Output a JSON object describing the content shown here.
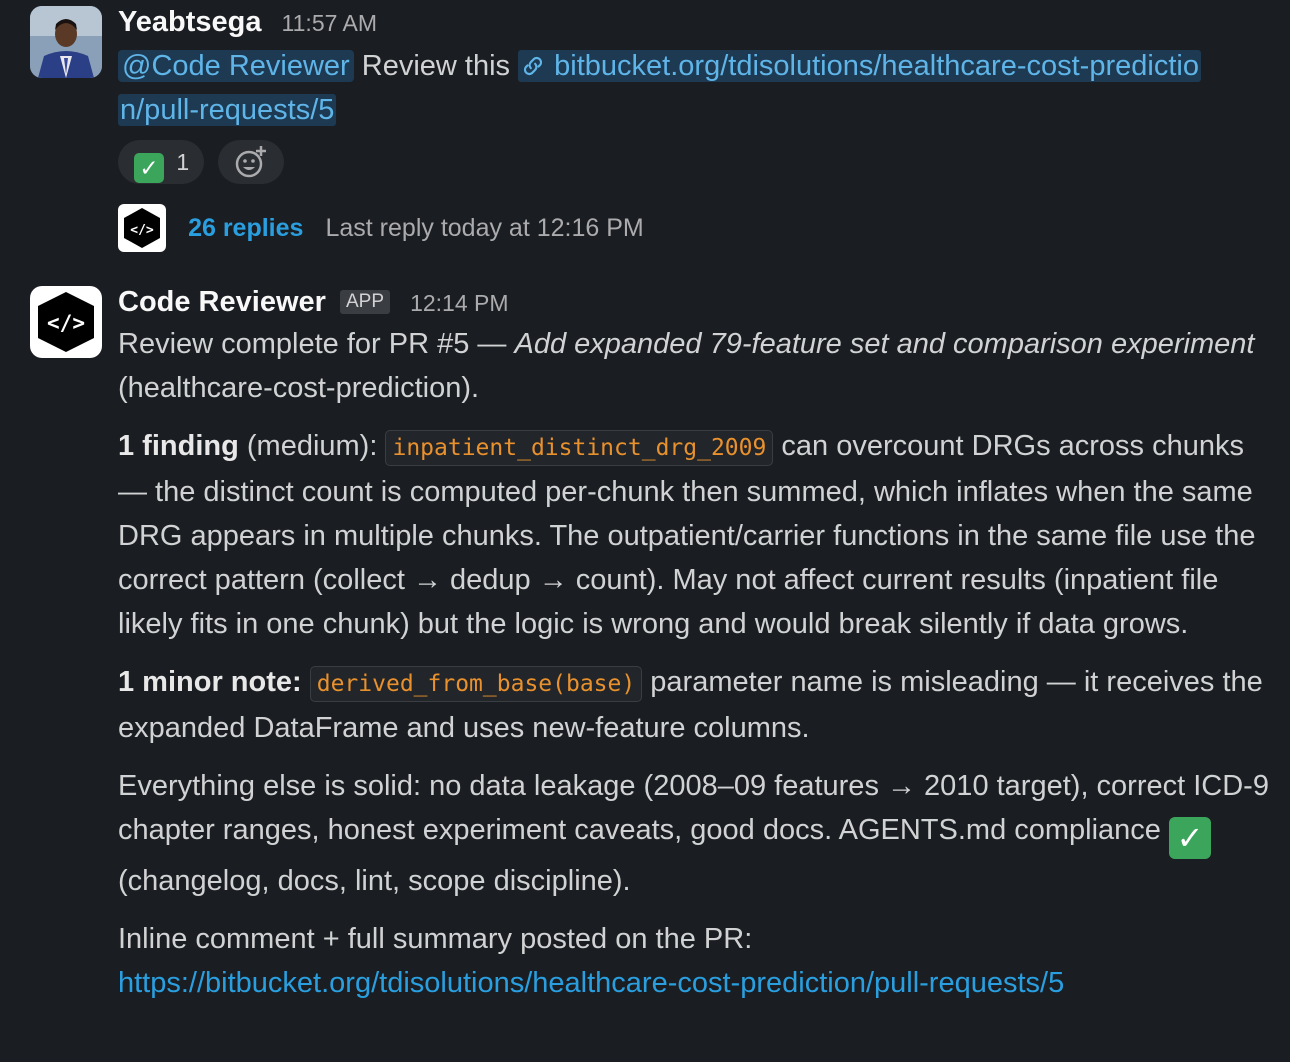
{
  "message1": {
    "author": "Yeabtsega",
    "time": "11:57 AM",
    "mention": "@Code Reviewer",
    "text": "Review this",
    "link_line1": "bitbucket.org/tdisolutions/healthcare-cost-predictio",
    "link_line2": "n/pull-requests/5",
    "reaction_count": "1",
    "thread": {
      "replies": "26 replies",
      "last_reply": "Last reply today at 12:16 PM"
    }
  },
  "message2": {
    "author": "Code Reviewer",
    "badge": "APP",
    "time": "12:14 PM",
    "intro_prefix": "Review complete for PR #5 — ",
    "intro_title": "Add expanded 79-feature set and comparison experiment",
    "intro_suffix": "(healthcare-cost-prediction).",
    "finding_label": "1 finding",
    "finding_severity": " (medium): ",
    "finding_code": "inpatient_distinct_drg_2009",
    "finding_text": " can overcount DRGs across chunks — the distinct count is computed per-chunk then summed, which inflates when the same DRG appears in multiple chunks. The outpatient/carrier functions in the same file use the correct pattern (collect → dedup → count). May not affect current results (inpatient file likely fits in one chunk) but the logic is wrong and would break silently if data grows.",
    "note_label": "1 minor note:",
    "note_code": "derived_from_base(base)",
    "note_text": " parameter name is misleading — it receives the expanded DataFrame and uses new-feature columns.",
    "summary_text": "Everything else is solid: no data leakage (2008–09 features → 2010 target), correct ICD-9 chapter ranges, honest experiment caveats, good docs. AGENTS.md compliance ",
    "summary_tail": " (changelog, docs, lint, scope discipline).",
    "inline_text": "Inline comment + full summary posted on the PR:",
    "pr_link": "https://bitbucket.org/tdisolutions/healthcare-cost-prediction/pull-requests/5"
  },
  "icons": {
    "check": "✓",
    "link": "link-icon",
    "add_reaction": "add-reaction-icon",
    "code_logo": "code-brackets-icon"
  },
  "colors": {
    "background": "#1a1d21",
    "link": "#2a9fe0",
    "code": "#e8912d",
    "check": "#3ba55c"
  }
}
